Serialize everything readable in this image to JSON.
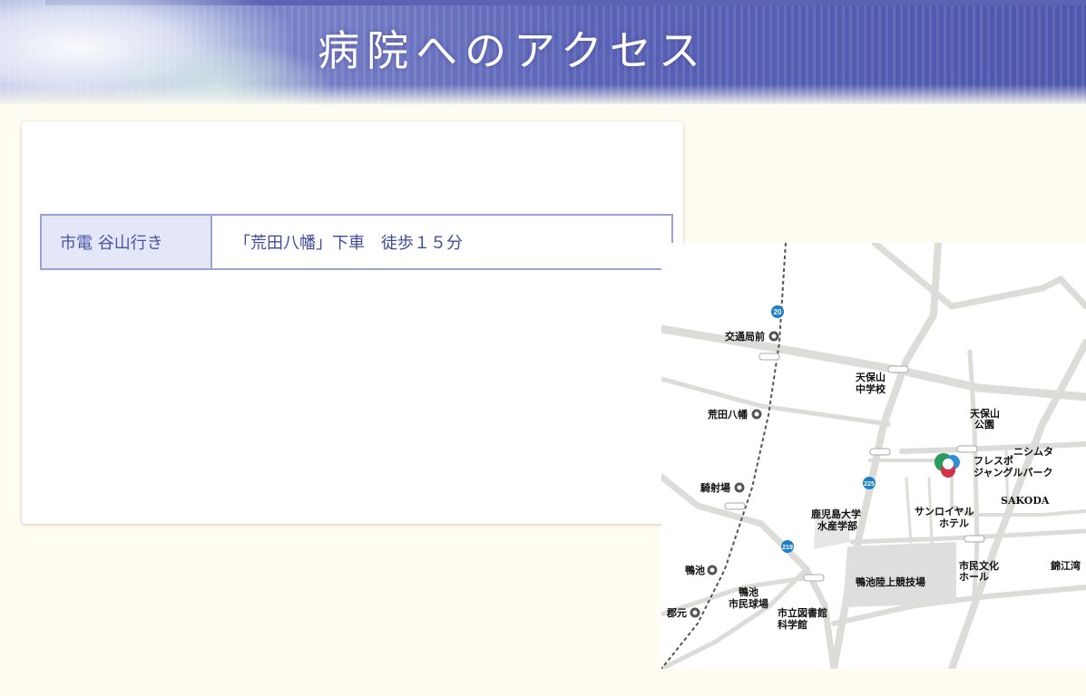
{
  "header": {
    "title": "病院へのアクセス"
  },
  "access": {
    "rows": [
      {
        "label": "市電  谷山行き",
        "value": "「荒田八幡」下車　徒歩１５分"
      }
    ]
  },
  "map": {
    "route_badges": [
      "20",
      "225",
      "219"
    ],
    "stations": [
      "交通局前",
      "荒田八幡",
      "騎射場",
      "鴨池",
      "郡元"
    ],
    "places": [
      "天保山\n中学校",
      "天保山\n公園",
      "ニシムタ",
      "フレスポ\nジャングルパーク",
      "SAKODA",
      "サンロイヤル\nホテル",
      "鹿児島大学\n水産学部",
      "市民文化\nホール",
      "錦江湾",
      "鴨池陸上競技場",
      "鴨池\n市民球場",
      "市立図書館\n科学館"
    ],
    "colors": {
      "road": "#dcdcd8",
      "rail": "#555555",
      "badge": "#1e7fc4",
      "field": "#dedede"
    }
  }
}
